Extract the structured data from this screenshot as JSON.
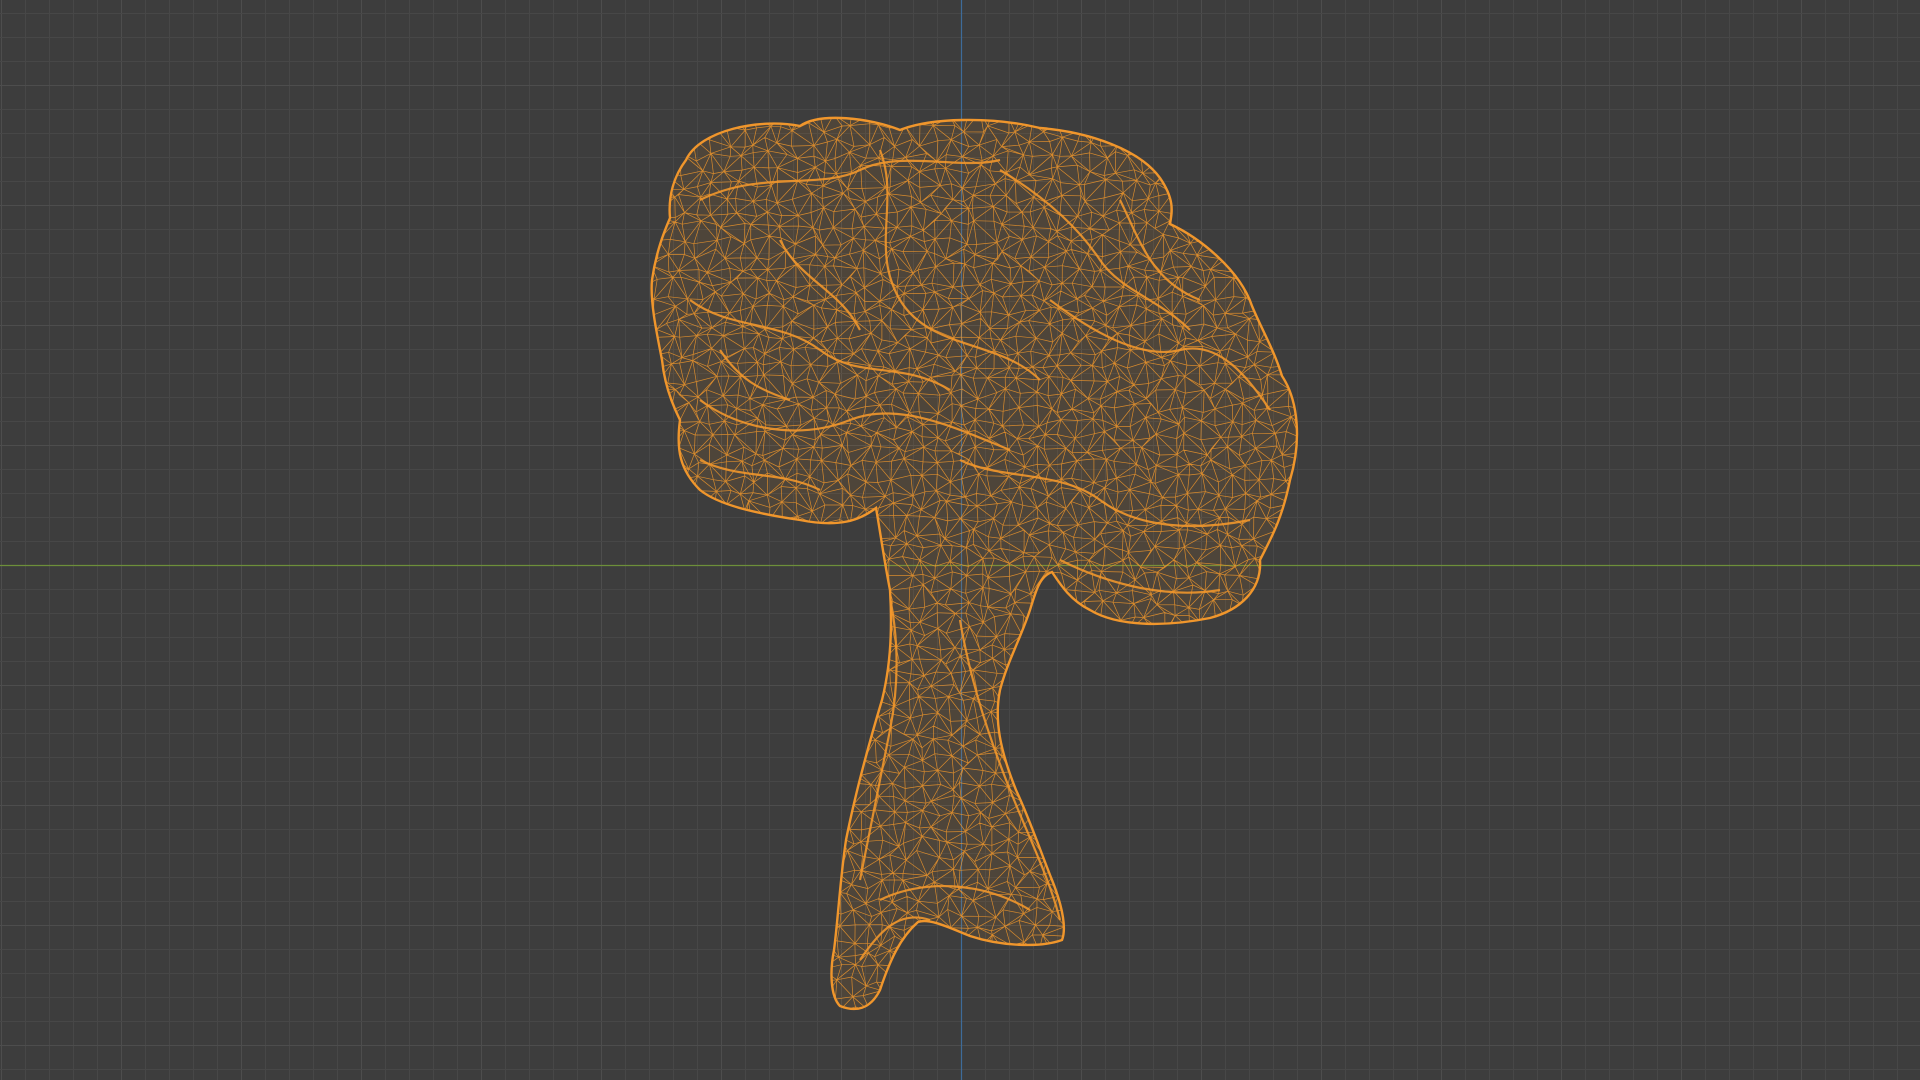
{
  "viewport": {
    "background": "#3d3d3d",
    "grid_minor_color": "#474747",
    "grid_major_color": "#4d4d4d",
    "x_axis_color": "#6d8f3a",
    "y_axis_color": "#3e6b99",
    "wire_color": "#f0962c",
    "mesh_icon": "wireframe-brain-mesh",
    "shading_mode": "wireframe"
  }
}
